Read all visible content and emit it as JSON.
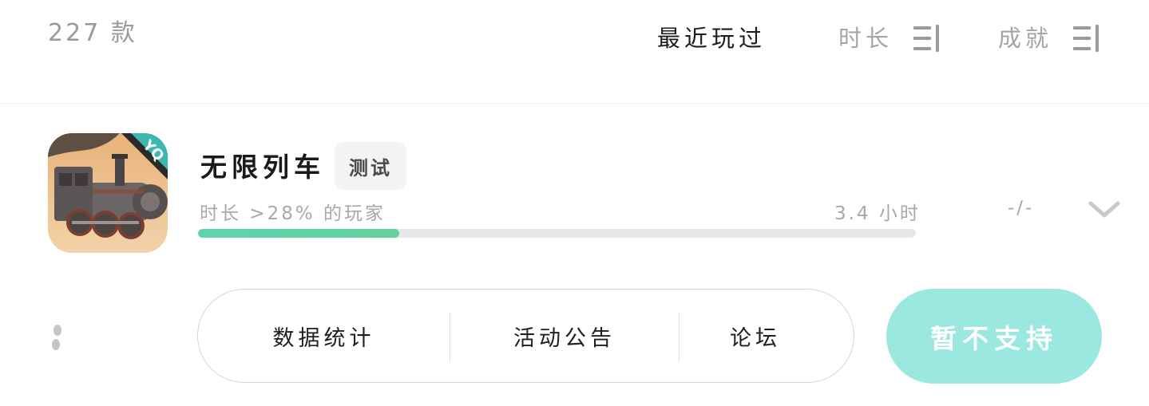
{
  "header": {
    "count": "227 款",
    "sort_recent": "最近玩过",
    "sort_duration": "时长",
    "sort_achievement": "成就"
  },
  "game": {
    "title": "无限列车",
    "tag": "测试",
    "icon_badge": "YQ",
    "stat_text": "时长 >28% 的玩家",
    "playtime": "3.4 小时",
    "achievement": "-/-",
    "progress_percent": 28
  },
  "actions": {
    "stats": "数据统计",
    "events": "活动公告",
    "forum": "论坛",
    "cta": "暂不支持"
  },
  "colors": {
    "accent": "#5fd3b1",
    "cta_bg": "#9ae8df"
  }
}
